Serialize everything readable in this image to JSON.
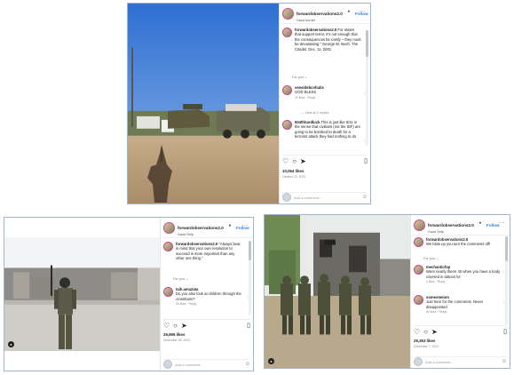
{
  "post1": {
    "username": "forwardobservations2.0",
    "follow": "Follow",
    "subtitle": "Gaza border",
    "caption": "For states that support terror, it's not enough that the consequences be costly – they must be devastating.\" George W. Bush. The Citadel, Dec. 11, 2001",
    "for_you": "For you",
    "comment1_user": "seneidebcohatis",
    "comment1_text": "GOD BLESS",
    "comment1_meta": "21 likes · Reply",
    "view_replies": "View all 2 replies",
    "comment2_user": "504thhardluck",
    "comment2_text": "This is just like 9/11 in the sense that civilians (not the IDF) are going to be bombed to death for a terrorist attack they had nothing to do",
    "likes": "10,064 likes",
    "date": "October 22, 2023",
    "add_comment": "Add a comment..."
  },
  "post2": {
    "username": "forwardobservations2.0",
    "follow": "Follow",
    "subtitle": "Gaza Strip",
    "caption": "\"Always bear in mind that your own resolution to succeed is more important than any other one thing.\"",
    "for_you": "For you",
    "comment_user": "taih.ama2ata",
    "comment_text": "Do you also look at children through the crosshairs?",
    "comment_meta": "30 likes · Reply",
    "likes": "29,995 likes",
    "date": "November 28, 2023",
    "add_comment": "Add a comment..."
  },
  "post3": {
    "username": "forwardobservations2.0",
    "follow": "Follow",
    "subtitle": "Gaza Strip",
    "comment1_user": "forwardobservations2.0",
    "comment1_text": "We blow up you turn the comments off!",
    "for_you": "For you",
    "comment2_user": "mechanticfop",
    "comment2_text": "Were nearly there! 40 when you have a body covered in tattoos lol",
    "comment2_meta": "4 likes · Reply",
    "comment3_user": "someoneinm",
    "comment3_text": "Just here for the comments. Never disappointed",
    "comment3_meta": "80 likes · Reply",
    "likes": "29,353 likes",
    "date": "December 7, 2023",
    "add_comment": "Add a comment..."
  }
}
